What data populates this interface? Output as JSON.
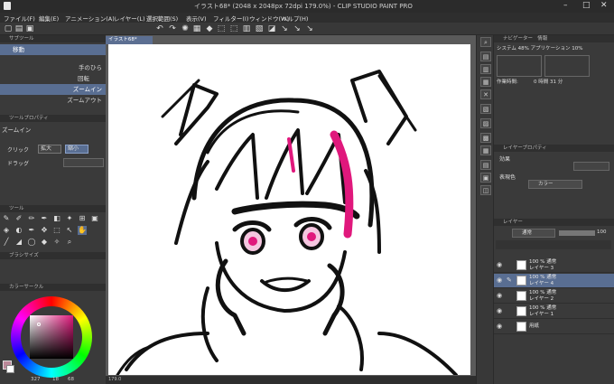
{
  "window": {
    "title": "イラスト68* (2048 x 2048px 72dpi 179.0%) - CLIP STUDIO PAINT PRO"
  },
  "menu": [
    "ファイル(F)",
    "編集(E)",
    "アニメーション(A)",
    "レイヤー(L)",
    "選択範囲(S)",
    "表示(V)",
    "フィルター(I)",
    "ウィンドウ(W)",
    "ヘルプ(H)"
  ],
  "subtool": {
    "header": "サブツール",
    "current": "移動",
    "items": [
      "手のひら",
      "回転",
      "ズームイン",
      "ズームアウト"
    ]
  },
  "tool_property": {
    "header": "ツールプロパティ",
    "title": "ズームイン",
    "click_label": "クリック",
    "zoom_in": "拡大",
    "zoom_out": "縮小",
    "drag_label": "ドラッグ"
  },
  "tool_header": "ツール",
  "brush_size_header": "ブラシサイズ",
  "color_header": "カラーサークル",
  "color_values": {
    "h": "327",
    "s": "18",
    "v": "68"
  },
  "canvas": {
    "tab": "イラスト68*",
    "zoom": "179.0"
  },
  "navigator": {
    "header": "ナビゲーター",
    "info_header": "情報",
    "system": "システム 48%",
    "app": "アプリケーション 10%",
    "time_label": "作業時間:",
    "time_value": "0 時間 31 分"
  },
  "layer_property": {
    "header": "レイヤープロパティ",
    "effect": "効果",
    "expression_color": "表現色",
    "color_mode": "カラー"
  },
  "layers_panel": {
    "header": "レイヤー",
    "blend": "通常",
    "opacity": "100"
  },
  "layers": [
    {
      "line1": "100 % 通常",
      "line2": "レイヤー 3",
      "selected": false
    },
    {
      "line1": "100 % 通常",
      "line2": "レイヤー 4",
      "selected": true
    },
    {
      "line1": "100 % 通常",
      "line2": "レイヤー 2",
      "selected": false
    },
    {
      "line1": "100 % 通常",
      "line2": "レイヤー 1",
      "selected": false
    },
    {
      "line1": "用紙",
      "line2": "",
      "selected": false
    }
  ],
  "colors": {
    "accent": "#596e92",
    "pink": "#e0187c"
  }
}
